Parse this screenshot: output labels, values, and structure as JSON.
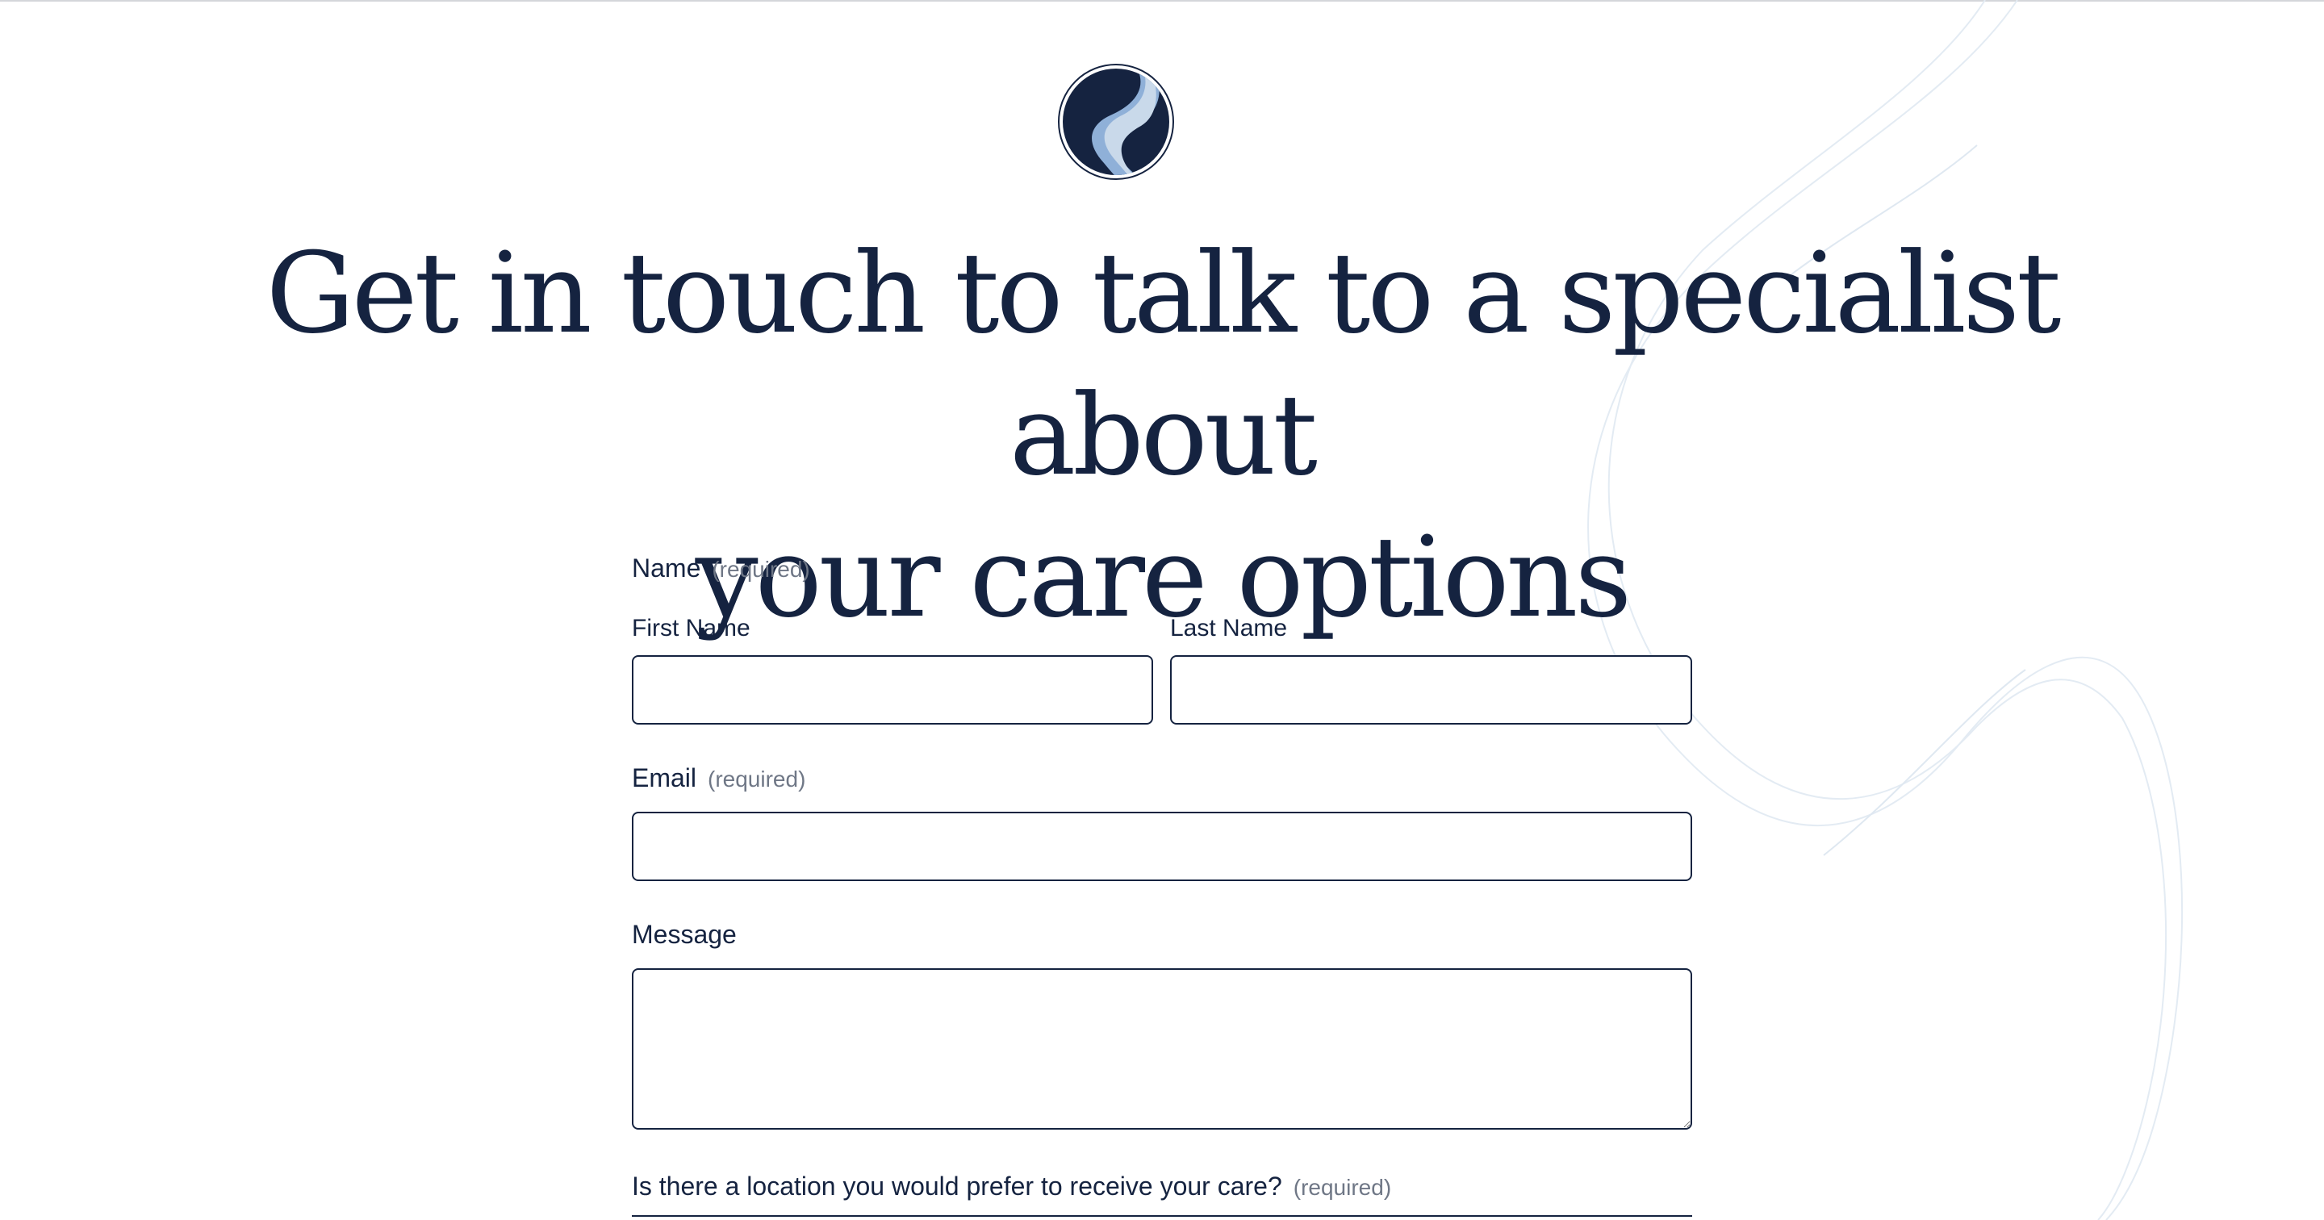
{
  "header": {
    "headline_line1": "Get in touch to talk to a specialist about",
    "headline_line2": "your care options",
    "logo_icon": "river-road-logo"
  },
  "form": {
    "name": {
      "label": "Name",
      "required": "(required)",
      "first_label": "First Name",
      "first_value": "",
      "last_label": "Last Name",
      "last_value": ""
    },
    "email": {
      "label": "Email",
      "required": "(required)",
      "value": ""
    },
    "message": {
      "label": "Message",
      "value": ""
    },
    "location": {
      "label": "Is there a location you would prefer to receive your care?",
      "required": "(required)"
    }
  },
  "colors": {
    "primary": "#152340",
    "muted": "#6f7786",
    "logo_light": "#8fb0d8",
    "logo_pale": "#c9d9ea",
    "decor_line": "#e3ebf3"
  }
}
